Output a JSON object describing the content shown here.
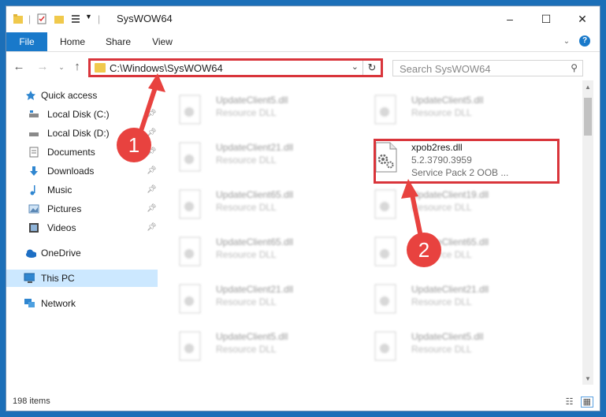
{
  "window": {
    "title": "SysWOW64",
    "controls": {
      "minimize": "–",
      "maximize": "☐",
      "close": "✕"
    }
  },
  "ribbon": {
    "tabs": [
      {
        "label": "File"
      },
      {
        "label": "Home"
      },
      {
        "label": "Share"
      },
      {
        "label": "View"
      }
    ],
    "help": "?"
  },
  "navigation": {
    "back_icon": "←",
    "forward_icon": "→",
    "up_icon": "↑",
    "address": "C:\\Windows\\SysWOW64",
    "search_placeholder": "Search SysWOW64"
  },
  "sidebar": {
    "items": [
      {
        "label": "Quick access",
        "icon": "star-icon",
        "pinned": false
      },
      {
        "label": "Local Disk (C:)",
        "icon": "drive-icon",
        "pinned": true
      },
      {
        "label": "Local Disk (D:)",
        "icon": "drive-icon",
        "pinned": true
      },
      {
        "label": "Documents",
        "icon": "documents-icon",
        "pinned": true
      },
      {
        "label": "Downloads",
        "icon": "downloads-icon",
        "pinned": true
      },
      {
        "label": "Music",
        "icon": "music-icon",
        "pinned": true
      },
      {
        "label": "Pictures",
        "icon": "pictures-icon",
        "pinned": true
      },
      {
        "label": "Videos",
        "icon": "videos-icon",
        "pinned": true
      },
      {
        "label": "OneDrive",
        "icon": "onedrive-icon",
        "pinned": false
      },
      {
        "label": "This PC",
        "icon": "pc-icon",
        "pinned": false,
        "selected": true
      },
      {
        "label": "Network",
        "icon": "network-icon",
        "pinned": false
      }
    ]
  },
  "files": {
    "left_column": [
      {
        "name": "UpdateClient5.dll",
        "desc": "Resource DLL"
      },
      {
        "name": "UpdateClient21.dll",
        "desc": "Resource DLL"
      },
      {
        "name": "UpdateClient65.dll",
        "desc": "Resource DLL"
      },
      {
        "name": "UpdateClient65.dll",
        "desc": "Resource DLL"
      },
      {
        "name": "UpdateClient21.dll",
        "desc": "Resource DLL"
      },
      {
        "name": "UpdateClient5.dll",
        "desc": "Resource DLL"
      }
    ],
    "right_column": [
      {
        "name": "UpdateClient5.dll",
        "desc": "Resource DLL"
      },
      {
        "name": "UpdateClient19.dll",
        "desc": "Resource DLL"
      },
      {
        "name": "UpdateClient65.dll",
        "desc": "Resource DLL"
      },
      {
        "name": "UpdateClient21.dll",
        "desc": "Resource DLL"
      },
      {
        "name": "UpdateClient5.dll",
        "desc": "Resource DLL"
      }
    ],
    "target": {
      "name": "xpob2res.dll",
      "version": "5.2.3790.3959",
      "desc": "Service Pack 2 OOB ..."
    }
  },
  "annotations": {
    "step1": "1",
    "step2": "2"
  },
  "status": {
    "count": "198 items"
  },
  "colors": {
    "accent": "#1979ca",
    "highlight": "#d9353b",
    "badge": "#e8423f"
  }
}
